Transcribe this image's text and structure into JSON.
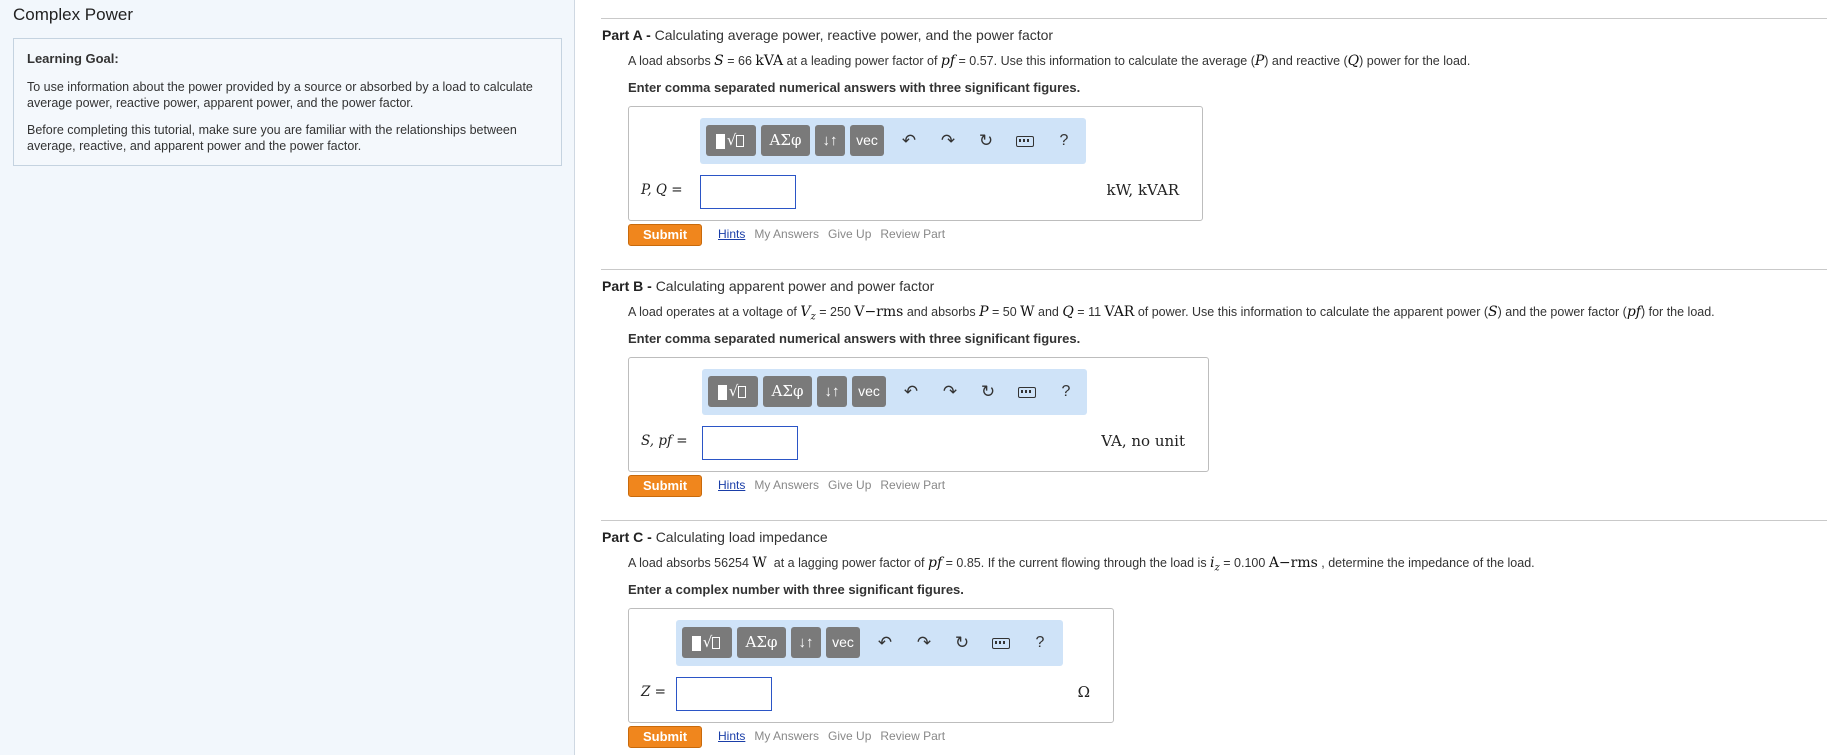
{
  "page_title": "Complex Power",
  "learning_goal": {
    "heading": "Learning Goal:",
    "paragraphs": [
      "To use information about the power provided by a source or absorbed by a load to calculate average power, reactive power, apparent power, and the power factor.",
      "Before completing this tutorial, make sure you are familiar with the relationships between average, reactive, and apparent power and the power factor."
    ]
  },
  "toolbar": {
    "template_symbol": "√",
    "greek_label": "ΑΣφ",
    "arrows_label": "↓↑",
    "vec_label": "vec",
    "undo_glyph": "↶",
    "redo_glyph": "↷",
    "reset_glyph": "↻",
    "help_label": "?"
  },
  "part_actions": {
    "submit": "Submit",
    "hints": "Hints",
    "my_answers": "My Answers",
    "give_up": "Give Up",
    "review_part": "Review Part"
  },
  "parts": [
    {
      "letter": "Part A - ",
      "title": "Calculating average power, reactive power, and the power factor",
      "q": {
        "t1": "A load absorbs ",
        "m1": "S",
        "t2": " = 66 ",
        "u1": "kVA",
        "t3": " at a leading power factor of ",
        "m2": "pf",
        "t4": " = 0.57. Use this information to calculate the average (",
        "m3": "P",
        "t5": ") and reactive (",
        "m4": "Q",
        "t6": ") power for the load."
      },
      "instruction": "Enter comma separated numerical answers with three significant figures.",
      "answer_label": "P, Q",
      "answer_value": "",
      "units": "kW, kVAR"
    },
    {
      "letter": "Part B - ",
      "title": "Calculating apparent power and power factor",
      "q": {
        "t1": "A load operates at a voltage of ",
        "m1": "V",
        "sub1": "z",
        "t2": " = 250 ",
        "u1": "V−rms",
        "t3": " and absorbs ",
        "m2": "P",
        "t4": " = 50 ",
        "u2": "W",
        "t5": " and ",
        "m3": "Q",
        "t6": " = 11 ",
        "u3": "VAR",
        "t7": " of power. Use this information to calculate the apparent power (",
        "m4": "S",
        "t8": ") and the power factor (",
        "m5": "pf",
        "t9": ") for the load."
      },
      "instruction": "Enter comma separated numerical answers with three significant figures.",
      "answer_label": "S, pf",
      "answer_value": "",
      "units": "VA, no unit"
    },
    {
      "letter": "Part C - ",
      "title": "Calculating load impedance",
      "q": {
        "t1": "A load absorbs 56254 ",
        "u1": "W",
        "t2": "  at a lagging power factor of ",
        "m1": "pf",
        "t3": " = 0.85. If the current flowing through the load is ",
        "m2": "i",
        "sub2": "z",
        "t4": " = 0.100 ",
        "u2": "A−rms",
        "t5": " , determine the impedance of the load."
      },
      "instruction": "Enter a complex number with three significant figures.",
      "answer_label": "Z",
      "answer_value": "",
      "units": "Ω"
    }
  ]
}
